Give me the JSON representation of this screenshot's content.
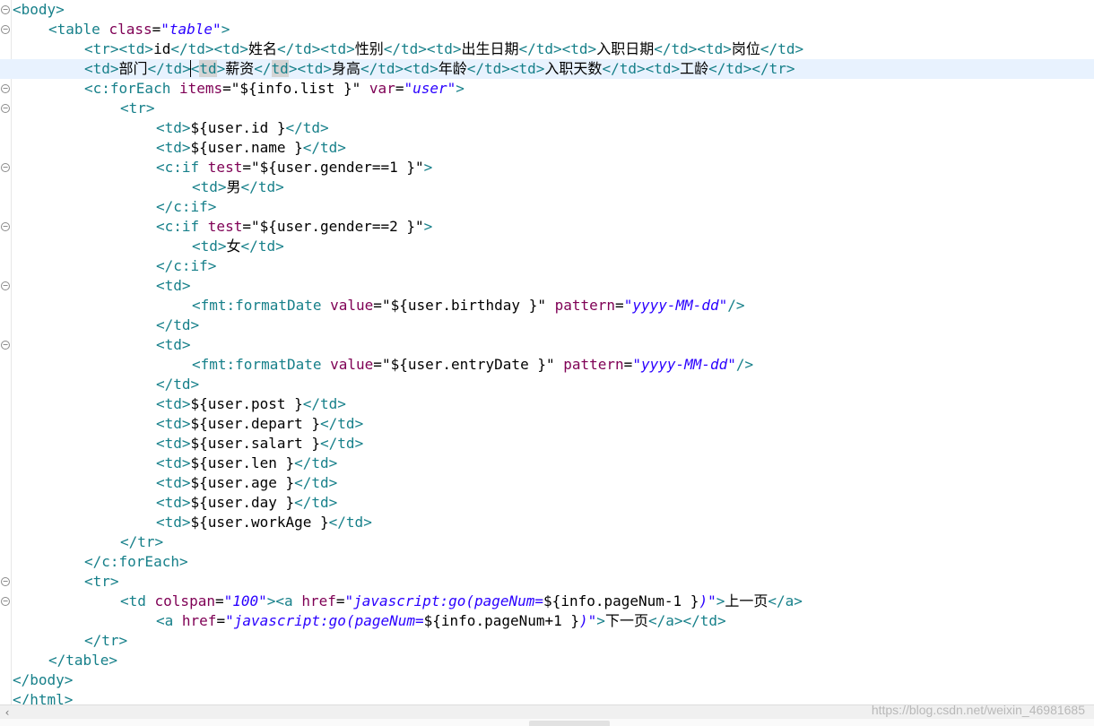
{
  "editor": {
    "current_line_index": 3,
    "lines": [
      {
        "indent": 0,
        "fold": "minus",
        "tokens": [
          [
            "tg",
            "<body>"
          ]
        ]
      },
      {
        "indent": 1,
        "fold": "minus",
        "tokens": [
          [
            "tg",
            "<table "
          ],
          [
            "at",
            "class"
          ],
          [
            "tx",
            "="
          ],
          [
            "av",
            "\"table\""
          ],
          [
            "tg",
            ">"
          ]
        ]
      },
      {
        "indent": 2,
        "fold": "",
        "tokens": [
          [
            "tg",
            "<tr><td>"
          ],
          [
            "tx",
            "id"
          ],
          [
            "tg",
            "</td><td>"
          ],
          [
            "tx",
            "姓名"
          ],
          [
            "tg",
            "</td><td>"
          ],
          [
            "tx",
            "性别"
          ],
          [
            "tg",
            "</td><td>"
          ],
          [
            "tx",
            "出生日期"
          ],
          [
            "tg",
            "</td><td>"
          ],
          [
            "tx",
            "入职日期"
          ],
          [
            "tg",
            "</td><td>"
          ],
          [
            "tx",
            "岗位"
          ],
          [
            "tg",
            "</td>"
          ]
        ]
      },
      {
        "indent": 2,
        "fold": "",
        "tokens": [
          [
            "tg",
            "<td>"
          ],
          [
            "tx",
            "部门"
          ],
          [
            "tg",
            "</td>"
          ],
          [
            "cur",
            ""
          ],
          [
            "tg",
            "<"
          ],
          [
            "hl",
            "td"
          ],
          [
            "tg",
            ">"
          ],
          [
            "tx",
            "薪资"
          ],
          [
            "tg",
            "</"
          ],
          [
            "hl",
            "td"
          ],
          [
            "tg",
            "><td>"
          ],
          [
            "tx",
            "身高"
          ],
          [
            "tg",
            "</td><td>"
          ],
          [
            "tx",
            "年龄"
          ],
          [
            "tg",
            "</td><td>"
          ],
          [
            "tx",
            "入职天数"
          ],
          [
            "tg",
            "</td><td>"
          ],
          [
            "tx",
            "工龄"
          ],
          [
            "tg",
            "</td></tr>"
          ]
        ]
      },
      {
        "indent": 2,
        "fold": "minus",
        "tokens": [
          [
            "tg",
            "<c:forEach "
          ],
          [
            "at",
            "items"
          ],
          [
            "tx",
            "="
          ],
          [
            "tx",
            "\"${info.list }\""
          ],
          [
            "tx",
            " "
          ],
          [
            "at",
            "var"
          ],
          [
            "tx",
            "="
          ],
          [
            "av",
            "\"user\""
          ],
          [
            "tg",
            ">"
          ]
        ]
      },
      {
        "indent": 3,
        "fold": "minus",
        "tokens": [
          [
            "tg",
            "<tr>"
          ]
        ]
      },
      {
        "indent": 4,
        "fold": "",
        "tokens": [
          [
            "tg",
            "<td>"
          ],
          [
            "tx",
            "${user.id }"
          ],
          [
            "tg",
            "</td>"
          ]
        ]
      },
      {
        "indent": 4,
        "fold": "",
        "tokens": [
          [
            "tg",
            "<td>"
          ],
          [
            "tx",
            "${user.name }"
          ],
          [
            "tg",
            "</td>"
          ]
        ]
      },
      {
        "indent": 4,
        "fold": "minus",
        "tokens": [
          [
            "tg",
            "<c:if "
          ],
          [
            "at",
            "test"
          ],
          [
            "tx",
            "="
          ],
          [
            "tx",
            "\"${user.gender==1 }\""
          ],
          [
            "tg",
            ">"
          ]
        ]
      },
      {
        "indent": 5,
        "fold": "",
        "tokens": [
          [
            "tg",
            "<td>"
          ],
          [
            "tx",
            "男"
          ],
          [
            "tg",
            "</td>"
          ]
        ]
      },
      {
        "indent": 4,
        "fold": "",
        "tokens": [
          [
            "tg",
            "</c:if>"
          ]
        ]
      },
      {
        "indent": 4,
        "fold": "minus",
        "tokens": [
          [
            "tg",
            "<c:if "
          ],
          [
            "at",
            "test"
          ],
          [
            "tx",
            "="
          ],
          [
            "tx",
            "\"${user.gender==2 }\""
          ],
          [
            "tg",
            ">"
          ]
        ]
      },
      {
        "indent": 5,
        "fold": "",
        "tokens": [
          [
            "tg",
            "<td>"
          ],
          [
            "tx",
            "女"
          ],
          [
            "tg",
            "</td>"
          ]
        ]
      },
      {
        "indent": 4,
        "fold": "",
        "tokens": [
          [
            "tg",
            "</c:if>"
          ]
        ]
      },
      {
        "indent": 4,
        "fold": "minus",
        "tokens": [
          [
            "tg",
            "<td>"
          ]
        ]
      },
      {
        "indent": 5,
        "fold": "",
        "tokens": [
          [
            "tg",
            "<fmt:formatDate "
          ],
          [
            "at",
            "value"
          ],
          [
            "tx",
            "="
          ],
          [
            "tx",
            "\"${user.birthday }\""
          ],
          [
            "tx",
            " "
          ],
          [
            "at",
            "pattern"
          ],
          [
            "tx",
            "="
          ],
          [
            "av",
            "\"yyyy-MM-dd\""
          ],
          [
            "tg",
            "/>"
          ]
        ]
      },
      {
        "indent": 4,
        "fold": "",
        "tokens": [
          [
            "tg",
            "</td>"
          ]
        ]
      },
      {
        "indent": 4,
        "fold": "minus",
        "tokens": [
          [
            "tg",
            "<td>"
          ]
        ]
      },
      {
        "indent": 5,
        "fold": "",
        "tokens": [
          [
            "tg",
            "<fmt:formatDate "
          ],
          [
            "at",
            "value"
          ],
          [
            "tx",
            "="
          ],
          [
            "tx",
            "\"${user.entryDate }\""
          ],
          [
            "tx",
            " "
          ],
          [
            "at",
            "pattern"
          ],
          [
            "tx",
            "="
          ],
          [
            "av",
            "\"yyyy-MM-dd\""
          ],
          [
            "tg",
            "/>"
          ]
        ]
      },
      {
        "indent": 4,
        "fold": "",
        "tokens": [
          [
            "tg",
            "</td>"
          ]
        ]
      },
      {
        "indent": 4,
        "fold": "",
        "tokens": [
          [
            "tg",
            "<td>"
          ],
          [
            "tx",
            "${user.post }"
          ],
          [
            "tg",
            "</td>"
          ]
        ]
      },
      {
        "indent": 4,
        "fold": "",
        "tokens": [
          [
            "tg",
            "<td>"
          ],
          [
            "tx",
            "${user.depart }"
          ],
          [
            "tg",
            "</td>"
          ]
        ]
      },
      {
        "indent": 4,
        "fold": "",
        "tokens": [
          [
            "tg",
            "<td>"
          ],
          [
            "tx",
            "${user.salart }"
          ],
          [
            "tg",
            "</td>"
          ]
        ]
      },
      {
        "indent": 4,
        "fold": "",
        "tokens": [
          [
            "tg",
            "<td>"
          ],
          [
            "tx",
            "${user.len }"
          ],
          [
            "tg",
            "</td>"
          ]
        ]
      },
      {
        "indent": 4,
        "fold": "",
        "tokens": [
          [
            "tg",
            "<td>"
          ],
          [
            "tx",
            "${user.age }"
          ],
          [
            "tg",
            "</td>"
          ]
        ]
      },
      {
        "indent": 4,
        "fold": "",
        "tokens": [
          [
            "tg",
            "<td>"
          ],
          [
            "tx",
            "${user.day }"
          ],
          [
            "tg",
            "</td>"
          ]
        ]
      },
      {
        "indent": 4,
        "fold": "",
        "tokens": [
          [
            "tg",
            "<td>"
          ],
          [
            "tx",
            "${user.workAge }"
          ],
          [
            "tg",
            "</td>"
          ]
        ]
      },
      {
        "indent": 3,
        "fold": "",
        "tokens": [
          [
            "tg",
            "</tr>"
          ]
        ]
      },
      {
        "indent": 2,
        "fold": "",
        "tokens": [
          [
            "tg",
            "</c:forEach>"
          ]
        ]
      },
      {
        "indent": 2,
        "fold": "minus",
        "tokens": [
          [
            "tg",
            "<tr>"
          ]
        ]
      },
      {
        "indent": 3,
        "fold": "minus",
        "tokens": [
          [
            "tg",
            "<td "
          ],
          [
            "at",
            "colspan"
          ],
          [
            "tx",
            "="
          ],
          [
            "av",
            "\"100\""
          ],
          [
            "tg",
            "><a "
          ],
          [
            "at",
            "href"
          ],
          [
            "tx",
            "="
          ],
          [
            "av",
            "\"javascript:go(pageNum="
          ],
          [
            "tx",
            "${info.pageNum-1 }"
          ],
          [
            "av",
            ")\""
          ],
          [
            "tg",
            ">"
          ],
          [
            "tx",
            "上一页"
          ],
          [
            "tg",
            "</a>"
          ]
        ]
      },
      {
        "indent": 4,
        "fold": "",
        "tokens": [
          [
            "tg",
            "<a "
          ],
          [
            "at",
            "href"
          ],
          [
            "tx",
            "="
          ],
          [
            "av",
            "\"javascript:go(pageNum="
          ],
          [
            "tx",
            "${info.pageNum+1 }"
          ],
          [
            "av",
            ")\""
          ],
          [
            "tg",
            ">"
          ],
          [
            "tx",
            "下一页"
          ],
          [
            "tg",
            "</a></td>"
          ]
        ]
      },
      {
        "indent": 2,
        "fold": "",
        "tokens": [
          [
            "tg",
            "</tr>"
          ]
        ]
      },
      {
        "indent": 1,
        "fold": "",
        "tokens": [
          [
            "tg",
            "</table>"
          ]
        ]
      },
      {
        "indent": 0,
        "fold": "",
        "tokens": [
          [
            "tg",
            "</body>"
          ]
        ]
      },
      {
        "indent": 0,
        "fold": "",
        "tokens": [
          [
            "tg",
            "</html>"
          ]
        ]
      }
    ]
  },
  "scrollbar": {
    "left_arrow": "‹"
  },
  "watermark": "https://blog.csdn.net/weixin_46981685"
}
